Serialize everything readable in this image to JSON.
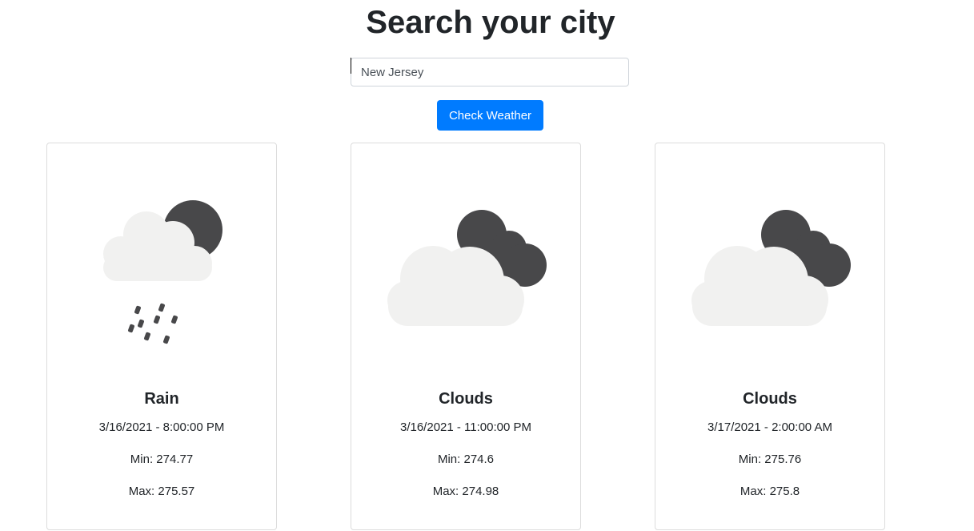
{
  "header": {
    "title": "Search your city"
  },
  "search": {
    "value": "New Jersey",
    "button_label": "Check Weather"
  },
  "cards": [
    {
      "condition": "Rain",
      "icon": "night-rain-icon",
      "datetime": "3/16/2021 - 8:00:00 PM",
      "min": "Min: 274.77",
      "max": "Max: 275.57"
    },
    {
      "condition": "Clouds",
      "icon": "night-clouds-icon",
      "datetime": "3/16/2021 - 11:00:00 PM",
      "min": "Min: 274.6",
      "max": "Max: 274.98"
    },
    {
      "condition": "Clouds",
      "icon": "night-clouds-icon",
      "datetime": "3/17/2021 - 2:00:00 AM",
      "min": "Min: 275.76",
      "max": "Max: 275.8"
    }
  ],
  "colors": {
    "button": "#007bff",
    "dark_cloud": "#48484a",
    "light_cloud": "#f1f1f0"
  }
}
